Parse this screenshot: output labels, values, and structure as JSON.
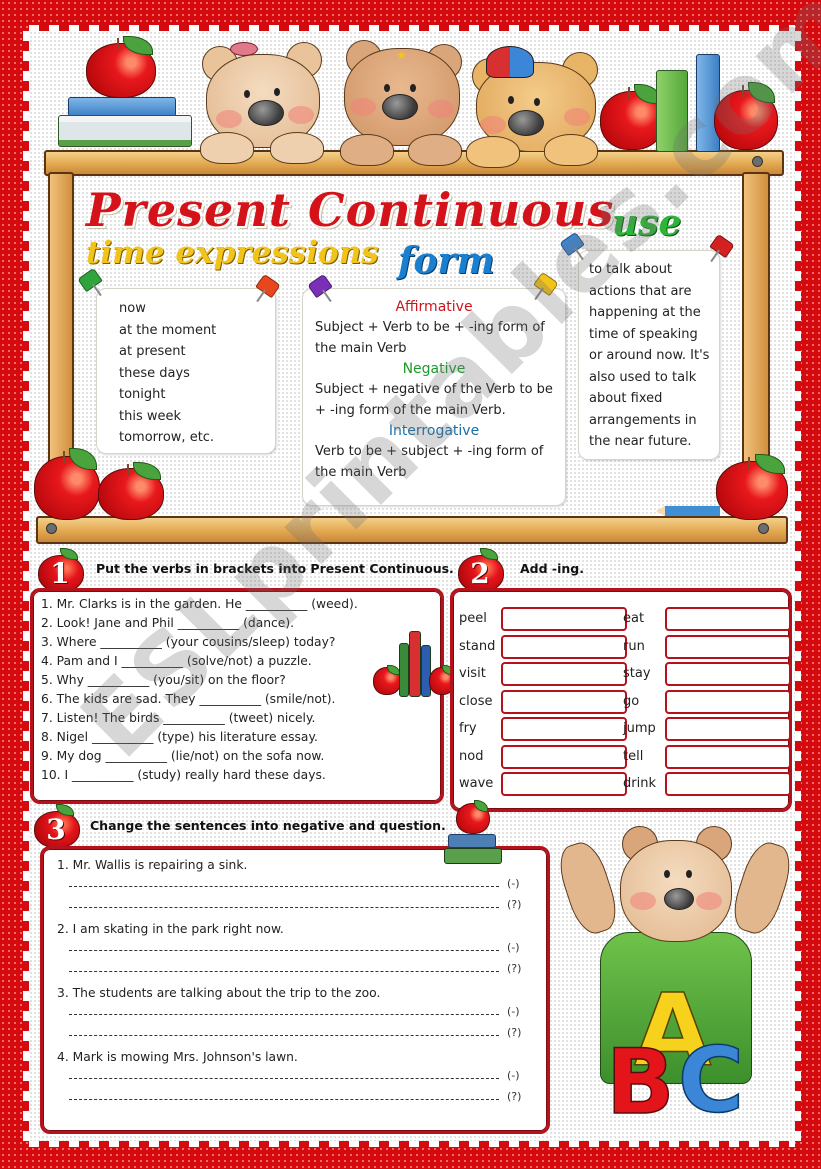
{
  "worksheet": {
    "title": "Present Continuous",
    "headings": {
      "time_expressions": "time expressions",
      "form": "form",
      "use": "use"
    },
    "time_expressions": [
      "now",
      "at the moment",
      "at present",
      "these days",
      "tonight",
      "this week",
      "tomorrow, etc."
    ],
    "form": {
      "affirmative_label": "Affirmative",
      "affirmative_text": "Subject + Verb to be + -ing form of the main Verb",
      "negative_label": "Negative",
      "negative_text": "Subject + negative of the Verb to be + -ing form of the main Verb.",
      "interrogative_label": "Interrogative",
      "interrogative_text": "Verb to be + subject + -ing form of the main Verb"
    },
    "use_text": "to talk about actions that are happening at the time of speaking or around now. It's also used to talk about fixed arrangements in the near future.",
    "colors": {
      "border_red": "#d40a0e",
      "box_red": "#b5121b",
      "title_red": "#d4121a",
      "time_yellow": "#f2c318",
      "form_blue": "#1a7fce",
      "use_green": "#2fb43a",
      "affirmative": "#c8161c",
      "negative": "#1e9a2a",
      "interrogative": "#1a6fa8"
    },
    "watermark": "ESLprintables.com"
  },
  "exercise1": {
    "number": "1",
    "instruction": "Put the verbs in brackets  into Present Continuous.",
    "items": [
      "1.  Mr. Clarks is in the garden. He __________ (weed).",
      "2.  Look! Jane and Phil __________ (dance).",
      "3.  Where __________ (your cousins/sleep) today?",
      "4.  Pam and I __________ (solve/not) a puzzle.",
      "5.  Why __________ (you/sit) on the floor?",
      "6.  The kids are sad. They __________ (smile/not).",
      "7.  Listen! The birds __________ (tweet) nicely.",
      "8.  Nigel __________ (type) his literature essay.",
      "9.  My dog __________ (lie/not) on the sofa now.",
      "10. I __________ (study) really hard these days."
    ]
  },
  "exercise2": {
    "number": "2",
    "instruction": "Add -ing.",
    "left_words": [
      "peel",
      "stand",
      "visit",
      "close",
      "fry",
      "nod",
      "wave"
    ],
    "right_words": [
      "eat",
      "run",
      "stay",
      "go",
      "jump",
      "tell",
      "drink"
    ],
    "answer_placeholder": ""
  },
  "exercise3": {
    "number": "3",
    "instruction": "Change the sentences into negative and question.",
    "negative_mark": "(-)",
    "question_mark": "(?)",
    "items": [
      "1.  Mr. Wallis is repairing a sink.",
      "2. I am skating in the park right now.",
      "3.  The students are talking about the trip to the zoo.",
      "4.  Mark is mowing Mrs. Johnson's lawn."
    ]
  }
}
